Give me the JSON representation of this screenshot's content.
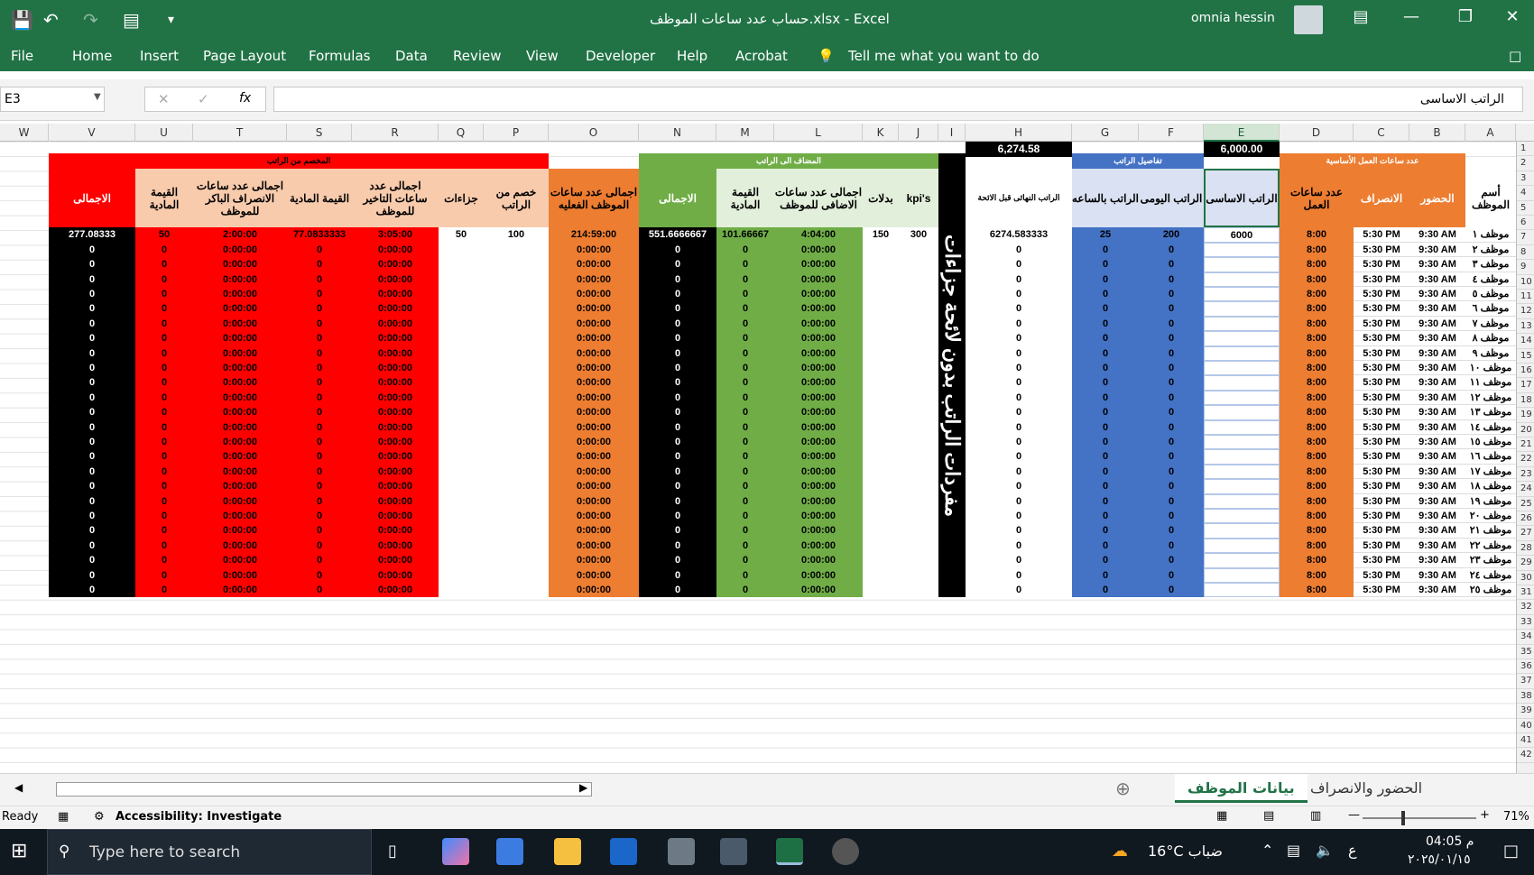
{
  "titlebar": {
    "title": "حساب عدد ساعات الموظف.xlsx  -  Excel",
    "user": "omnia hessin"
  },
  "menu": [
    "File",
    "Home",
    "Insert",
    "Page Layout",
    "Formulas",
    "Data",
    "Review",
    "View",
    "Developer",
    "Help",
    "Acrobat"
  ],
  "tell_me": "Tell me what you want to do",
  "formula_bar": {
    "name_box": "E3",
    "fx": "fx",
    "content": "الراتب الاساسى"
  },
  "columns": [
    "A",
    "B",
    "C",
    "D",
    "E",
    "F",
    "G",
    "H",
    "I",
    "J",
    "K",
    "L",
    "M",
    "N",
    "O",
    "P",
    "Q",
    "R",
    "S",
    "T",
    "U",
    "V",
    "W"
  ],
  "rows": [
    "1",
    "2",
    "3",
    "4",
    "5",
    "6",
    "7",
    "8",
    "9",
    "10",
    "11",
    "12",
    "13",
    "14",
    "15",
    "16",
    "17",
    "18",
    "19",
    "20",
    "21",
    "22",
    "23",
    "24",
    "25",
    "26",
    "27",
    "28",
    "29",
    "30",
    "31",
    "32",
    "33",
    "34",
    "35",
    "36",
    "37",
    "38",
    "39",
    "40",
    "41",
    "42"
  ],
  "sheet": {
    "totals": {
      "h_total": "6,274.58",
      "e_total": "6,000.00"
    },
    "group_headers": {
      "basic_hours": "عدد ساعات العمل الأساسية",
      "salary_details": "تفاصيل الراتب",
      "added": "المضاف الى الراتب",
      "deducted": "المخصم من الراتب"
    },
    "headers": {
      "A": "أسم الموظف",
      "B": "الحضور",
      "C": "الانصراف",
      "D": "عدد ساعات العمل",
      "E": "الراتب الاساسى",
      "F": "الراتب اليومى",
      "G": "الراتب بالساعه",
      "H": "الراتب النهائى قبل الائحة",
      "I": "مفردات الراتب بدون لائحة جزاءات",
      "J": "kpi's",
      "K": "بدلات",
      "L": "اجمالى عدد ساعات الاضافى للموظف",
      "M": "القيمة المادية",
      "N": "الاجمالى",
      "O": "اجمالى عدد ساعات الموظف الفعليه",
      "P": "خصم من الراتب",
      "Q": "جزاءات",
      "R": "اجمالى عدد ساعات التاخير للموظف",
      "S": "القيمة المادية",
      "T": "اجمالى عدد ساعات الانصراف الباكر للموظف",
      "U": "القيمة المادية",
      "V": "الاجمالى"
    },
    "first_row": {
      "B": "9:30 AM",
      "C": "5:30 PM",
      "D": "8:00",
      "E": "6000",
      "F": "200",
      "G": "25",
      "H": "6274.583333",
      "J": "300",
      "K": "150",
      "L": "4:04:00",
      "M": "101.66667",
      "N": "551.6666667",
      "O": "214:59:00",
      "P": "100",
      "Q": "50",
      "R": "3:05:00",
      "S": "77.0833333",
      "T": "2:00:00",
      "U": "50",
      "V": "277.08333"
    },
    "other_rows": {
      "B": "9:30 AM",
      "C": "5:30 PM",
      "D": "8:00",
      "F": "0",
      "G": "0",
      "H": "0",
      "L": "0:00:00",
      "M": "0",
      "N": "0",
      "O": "0:00:00",
      "R": "0:00:00",
      "S": "0",
      "T": "0:00:00",
      "U": "0",
      "V": "0"
    },
    "employees": [
      "موظف ١",
      "موظف ٢",
      "موظف ٣",
      "موظف ٤",
      "موظف ٥",
      "موظف ٦",
      "موظف ٧",
      "موظف ٨",
      "موظف ٩",
      "موظف ١٠",
      "موظف ١١",
      "موظف ١٢",
      "موظف ١٣",
      "موظف ١٤",
      "موظف ١٥",
      "موظف ١٦",
      "موظف ١٧",
      "موظف ١٨",
      "موظف ١٩",
      "موظف ٢٠",
      "موظف ٢١",
      "موظف ٢٢",
      "موظف ٢٣",
      "موظف ٢٤",
      "موظف ٢٥"
    ]
  },
  "tabs": {
    "active": "بيانات الموظف",
    "other": "الحضور والانصراف"
  },
  "status": {
    "ready": "Ready",
    "accessibility": "Accessibility: Investigate",
    "zoom": "71%"
  },
  "taskbar": {
    "search": "Type here to search",
    "weather": "16°C  ضباب",
    "time": "04:05 م",
    "date": "٢٠٢٥/٠١/١٥",
    "lang": "ع"
  },
  "colors": {
    "excel_green": "#217346",
    "orange": "#ED7D31",
    "blue": "#4472C4",
    "light_blue": "#D9E1F2",
    "green": "#70AD47",
    "light_green": "#E2EFDA",
    "red": "#FF0000",
    "pink": "#F8CBAD"
  }
}
